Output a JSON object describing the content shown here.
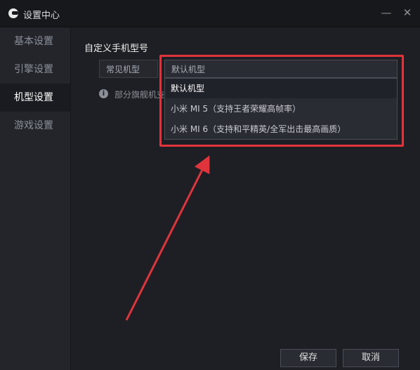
{
  "window": {
    "title": "设置中心",
    "minimize_glyph": "—",
    "close_glyph": "✕"
  },
  "sidebar": {
    "items": [
      {
        "label": "基本设置",
        "active": false
      },
      {
        "label": "引擎设置",
        "active": false
      },
      {
        "label": "机型设置",
        "active": true
      },
      {
        "label": "游戏设置",
        "active": false
      }
    ]
  },
  "main": {
    "section_title": "自定义手机型号",
    "category_select": {
      "value": "常见机型"
    },
    "model_select": {
      "value": "默认机型",
      "options": [
        {
          "label": "默认机型",
          "selected": true
        },
        {
          "label": "小米 MI 5（支持王者荣耀高帧率）",
          "selected": false
        },
        {
          "label": "小米 MI 6（支持和平精英/全军出击最高画质）",
          "selected": false
        }
      ]
    },
    "info_text": "部分旗舰机支"
  },
  "footer": {
    "save_label": "保存",
    "cancel_label": "取消"
  },
  "colors": {
    "annotation": "#e0343c",
    "background": "#1e1f24",
    "sidebar": "#23252b"
  },
  "icons": {
    "app": "app-logo-icon",
    "info": "info-icon",
    "caret": "caret-down-icon"
  }
}
